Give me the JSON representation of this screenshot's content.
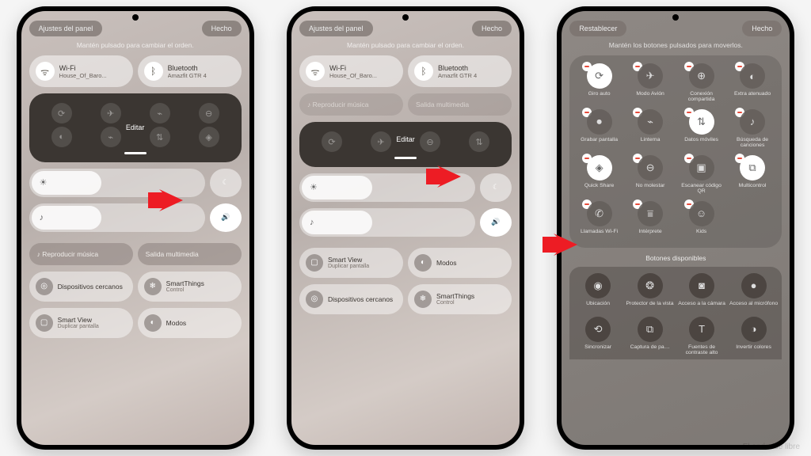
{
  "phones": {
    "p1": {
      "settings": "Ajustes del panel",
      "done": "Hecho",
      "hint": "Mantén pulsado para cambiar el orden.",
      "wifi": {
        "label": "Wi-Fi",
        "sub": "House_Of_Baro..."
      },
      "bluetooth": {
        "label": "Bluetooth",
        "sub": "Amazfit GTR 4"
      },
      "edit": "Editar",
      "play_music": "♪ Reproducir música",
      "media_out": "Salida multimedia",
      "devices": {
        "label": "Dispositivos cercanos",
        "sub": ""
      },
      "smartthings": {
        "label": "SmartThings",
        "sub": "Control"
      },
      "smartview": {
        "label": "Smart View",
        "sub": "Duplicar pantalla"
      },
      "modes": {
        "label": "Modos",
        "sub": ""
      }
    },
    "p2": {
      "settings": "Ajustes del panel",
      "done": "Hecho",
      "hint": "Mantén pulsado para cambiar el orden.",
      "wifi": {
        "label": "Wi-Fi",
        "sub": "House_Of_Baro..."
      },
      "bluetooth": {
        "label": "Bluetooth",
        "sub": "Amazfit GTR 4"
      },
      "edit": "Editar",
      "play_music": "♪ Reproducir música",
      "media_out": "Salida multimedia",
      "smartview": {
        "label": "Smart View",
        "sub": "Duplicar pantalla"
      },
      "modes": {
        "label": "Modos",
        "sub": ""
      },
      "devices": {
        "label": "Dispositivos cercanos",
        "sub": ""
      },
      "smartthings": {
        "label": "SmartThings",
        "sub": "Control"
      }
    },
    "p3": {
      "reset": "Restablecer",
      "done": "Hecho",
      "hint": "Mantén los botones pulsados para moverlos.",
      "grid": [
        {
          "label": "Giro auto",
          "glyph": "⟳",
          "white": true
        },
        {
          "label": "Modo Avión",
          "glyph": "✈",
          "white": false
        },
        {
          "label": "Conexión compartida",
          "glyph": "⊕",
          "white": false
        },
        {
          "label": "Extra atenuado",
          "glyph": "◐",
          "white": false
        },
        {
          "label": "Grabar pantalla",
          "glyph": "⏺",
          "white": false
        },
        {
          "label": "Linterna",
          "glyph": "⌁",
          "white": false
        },
        {
          "label": "Datos móviles",
          "glyph": "⇅",
          "white": true
        },
        {
          "label": "Búsqueda de canciones",
          "glyph": "♪",
          "white": false
        },
        {
          "label": "Quick Share",
          "glyph": "◈",
          "white": true
        },
        {
          "label": "No molestar",
          "glyph": "⊖",
          "white": false
        },
        {
          "label": "Escanear código QR",
          "glyph": "▣",
          "white": false
        },
        {
          "label": "Multicontrol",
          "glyph": "⧉",
          "white": true
        },
        {
          "label": "Llamadas Wi-Fi",
          "glyph": "✆",
          "white": false
        },
        {
          "label": "Intérprete",
          "glyph": "⩸",
          "white": false
        },
        {
          "label": "Kids",
          "glyph": "☺",
          "white": false
        }
      ],
      "avail_title": "Botones disponibles",
      "avail": [
        {
          "label": "Ubicación",
          "glyph": "◉"
        },
        {
          "label": "Protector de la vista",
          "glyph": "❂"
        },
        {
          "label": "Acceso a la cámara",
          "glyph": "◙"
        },
        {
          "label": "Acceso al micrófono",
          "glyph": "●"
        },
        {
          "label": "Sincronizar",
          "glyph": "⟲"
        },
        {
          "label": "Captura de pa…",
          "glyph": "⧉"
        },
        {
          "label": "Fuentes de contraste alto",
          "glyph": "T"
        },
        {
          "label": "Invertir colores",
          "glyph": "◑"
        }
      ]
    }
  },
  "watermark": "El androide libre"
}
